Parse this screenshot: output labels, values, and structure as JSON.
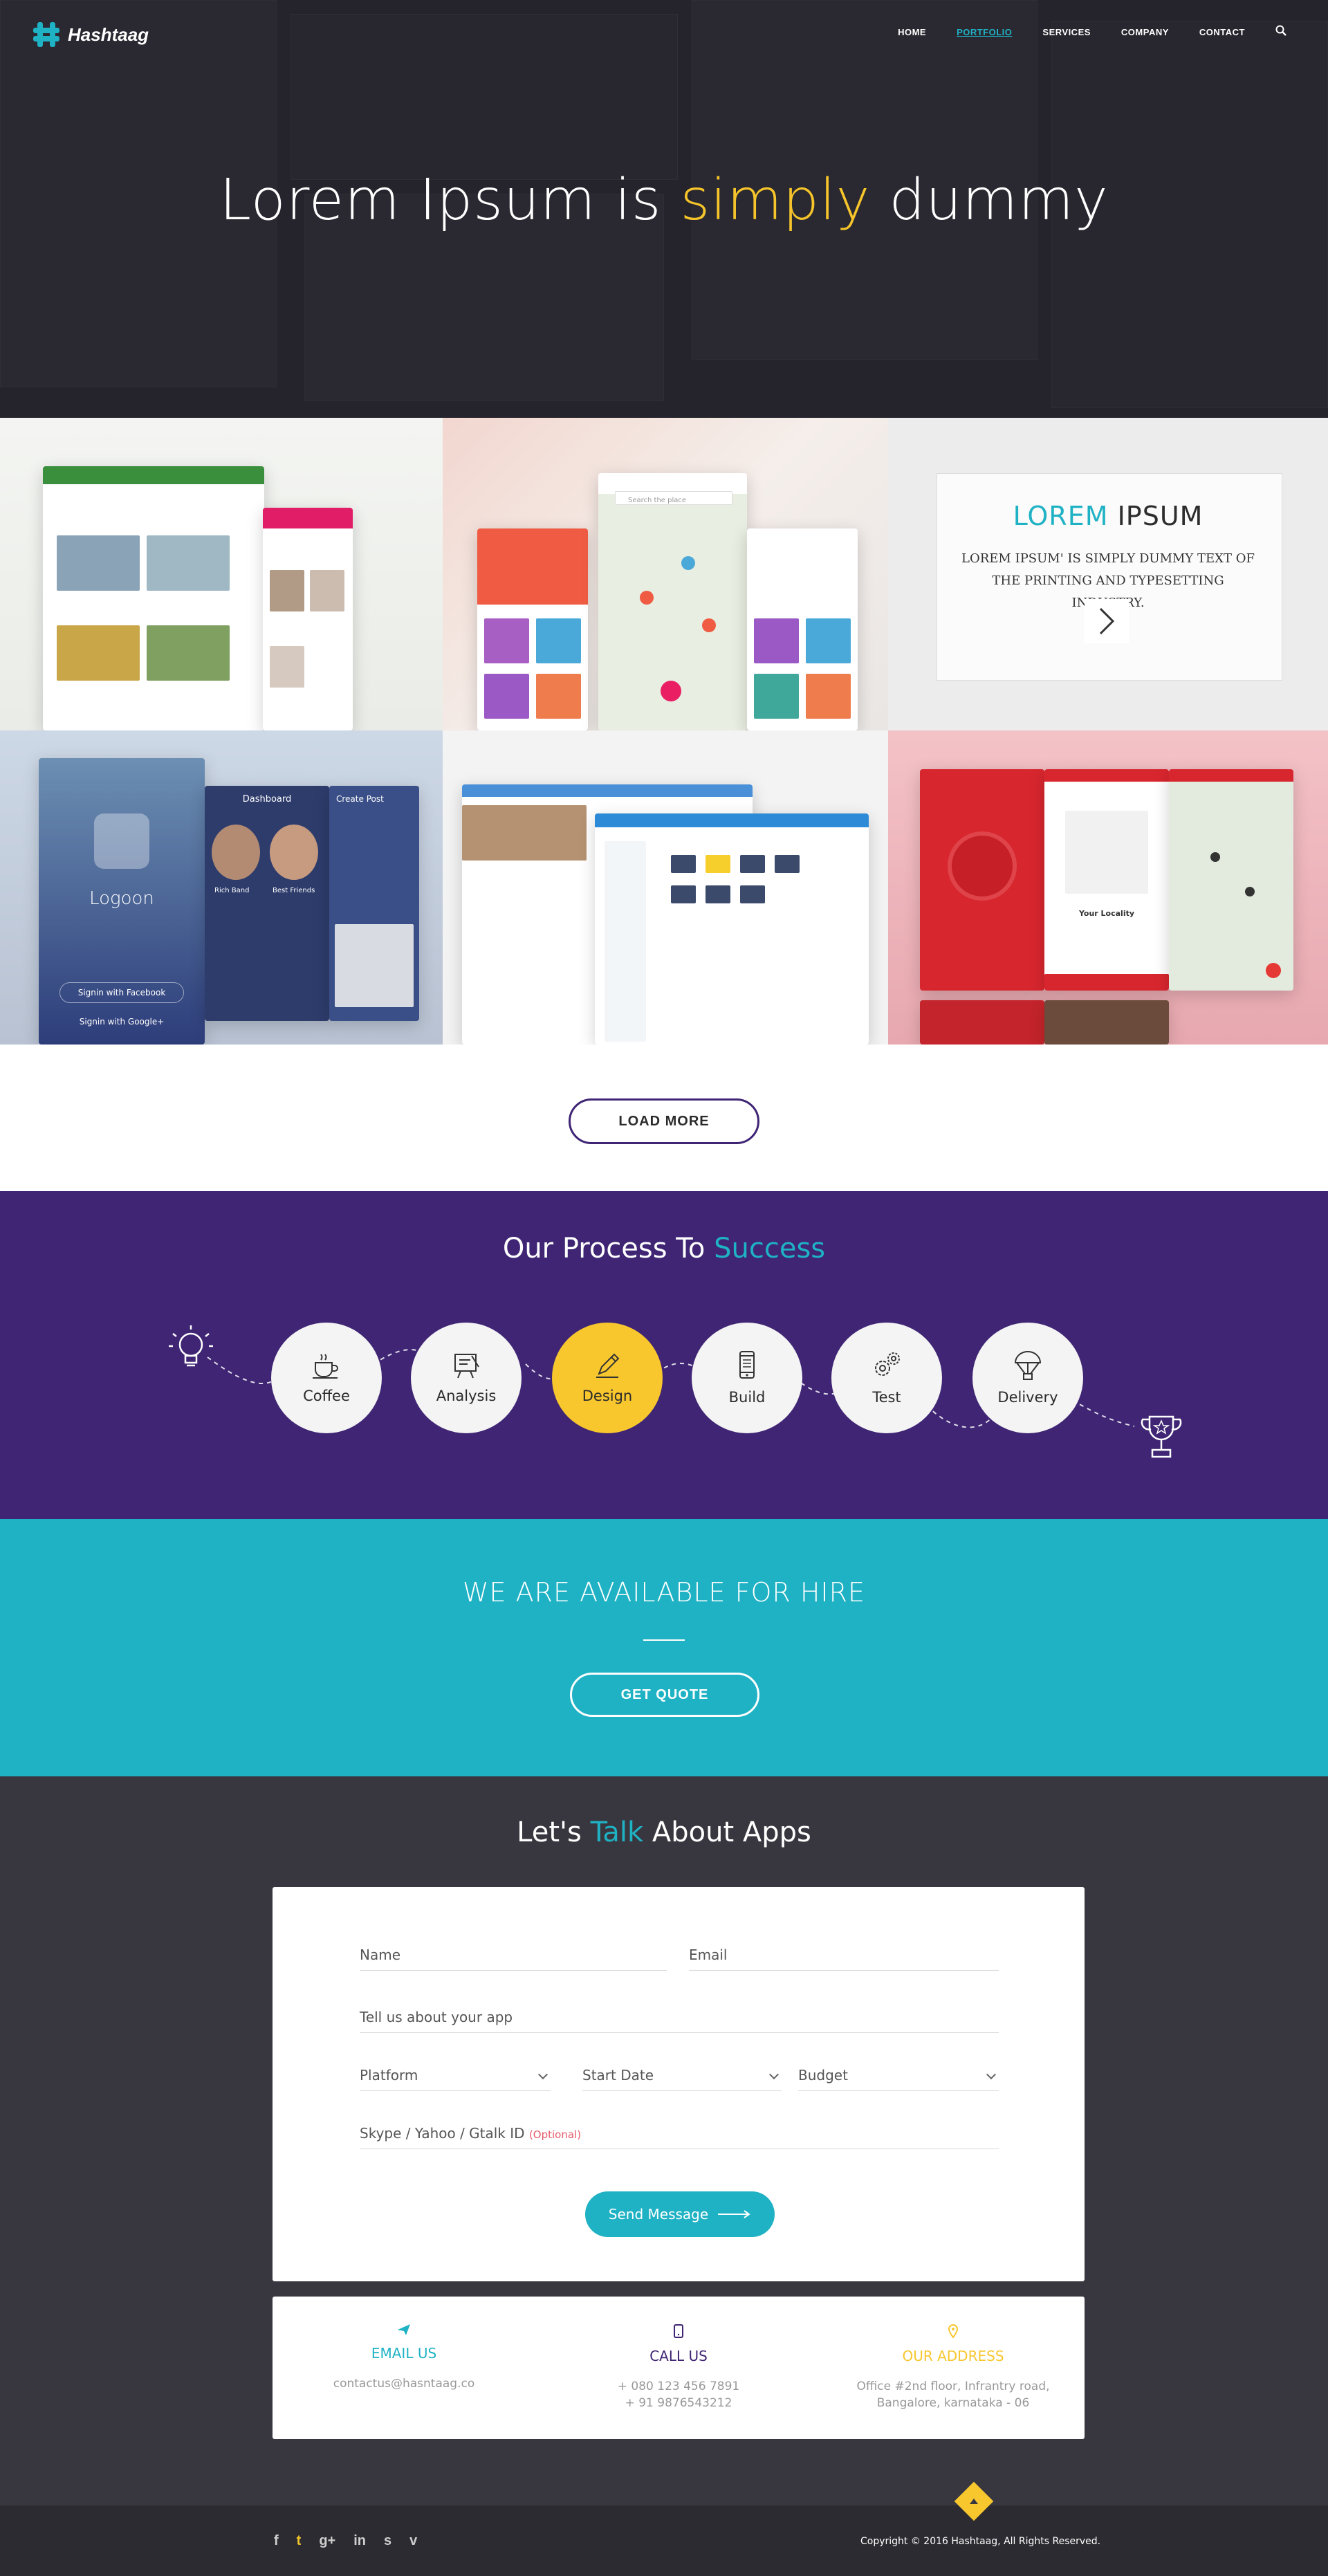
{
  "header": {
    "brand": "Hashtaag",
    "nav": [
      "HOME",
      "PORTFOLIO",
      "SERVICES",
      "COMPANY",
      "CONTACT"
    ],
    "active_nav": "PORTFOLIO"
  },
  "hero": {
    "title_pre": "Lorem Ipsum is ",
    "title_highlight": "simply",
    "title_post": " dummy",
    "highlight_color": "#f6c52b"
  },
  "portfolio": {
    "feature_title_accent": "LOREM",
    "feature_title_rest": " IPSUM",
    "feature_text": "LOREM IPSUM' IS SIMPLY DUMMY TEXT OF THE PRINTING AND TYPESETTING INDUSTRY.",
    "mock_labels": {
      "logoon": "Logoon",
      "signin_facebook": "Signin with Facebook",
      "signin_google": "Signin with Google+",
      "dashboard": "Dashboard",
      "create_post": "Create Post",
      "rich_band": "Rich Band",
      "best_friends": "Best Friends",
      "your_locality": "Your Locality",
      "search_place": "Search the place"
    }
  },
  "load_more": {
    "label": "LOAD MORE"
  },
  "process": {
    "title_pre": "Our Process To ",
    "title_highlight": "Success",
    "steps": [
      {
        "label": "Coffee",
        "icon": "coffee-cup-icon"
      },
      {
        "label": "Analysis",
        "icon": "analysis-board-icon"
      },
      {
        "label": "Design",
        "icon": "pencil-icon",
        "active": true
      },
      {
        "label": "Build",
        "icon": "mobile-phone-icon"
      },
      {
        "label": "Test",
        "icon": "gears-icon"
      },
      {
        "label": "Delivery",
        "icon": "parachute-icon"
      }
    ],
    "start_icon": "lightbulb-icon",
    "end_icon": "trophy-icon",
    "active_color": "#f8c72e"
  },
  "hire": {
    "title": "WE ARE AVAILABLE FOR HIRE",
    "button": "GET QUOTE"
  },
  "talk": {
    "title_pre": "Let's ",
    "title_highlight": "Talk",
    "title_post": " About Apps",
    "fields": {
      "name": "Name",
      "email": "Email",
      "about": "Tell us about your app",
      "platform": "Platform",
      "start_date": "Start Date",
      "budget": "Budget",
      "im": "Skype / Yahoo / Gtalk ID",
      "im_optional": "(Optional)"
    },
    "send": "Send Message"
  },
  "contact": {
    "email_title": "EMAIL US",
    "email_value": "contactus@hasntaag.co",
    "call_title": "CALL US",
    "call_value_1": "+ 080 123 456 7891",
    "call_value_2": "+ 91 9876543212",
    "address_title": "OUR ADDRESS",
    "address_value_1": "Office #2nd floor, Infrantry road,",
    "address_value_2": "Bangalore, karnataka - 06",
    "colors": {
      "email": "#1fb2c4",
      "call": "#3f2574",
      "address": "#f8c72e"
    }
  },
  "footer": {
    "social": [
      "f",
      "t",
      "g+",
      "in",
      "s",
      "v"
    ],
    "social_icons": [
      "facebook-icon",
      "twitter-icon",
      "google-plus-icon",
      "linkedin-icon",
      "skype-icon",
      "vimeo-icon"
    ],
    "copyright": "Copyright © 2016 Hashtaag, All Rights Reserved."
  },
  "colors": {
    "teal": "#1fb2c4",
    "purple": "#3f2574",
    "yellow": "#f8c72e",
    "dark": "#38373f"
  }
}
